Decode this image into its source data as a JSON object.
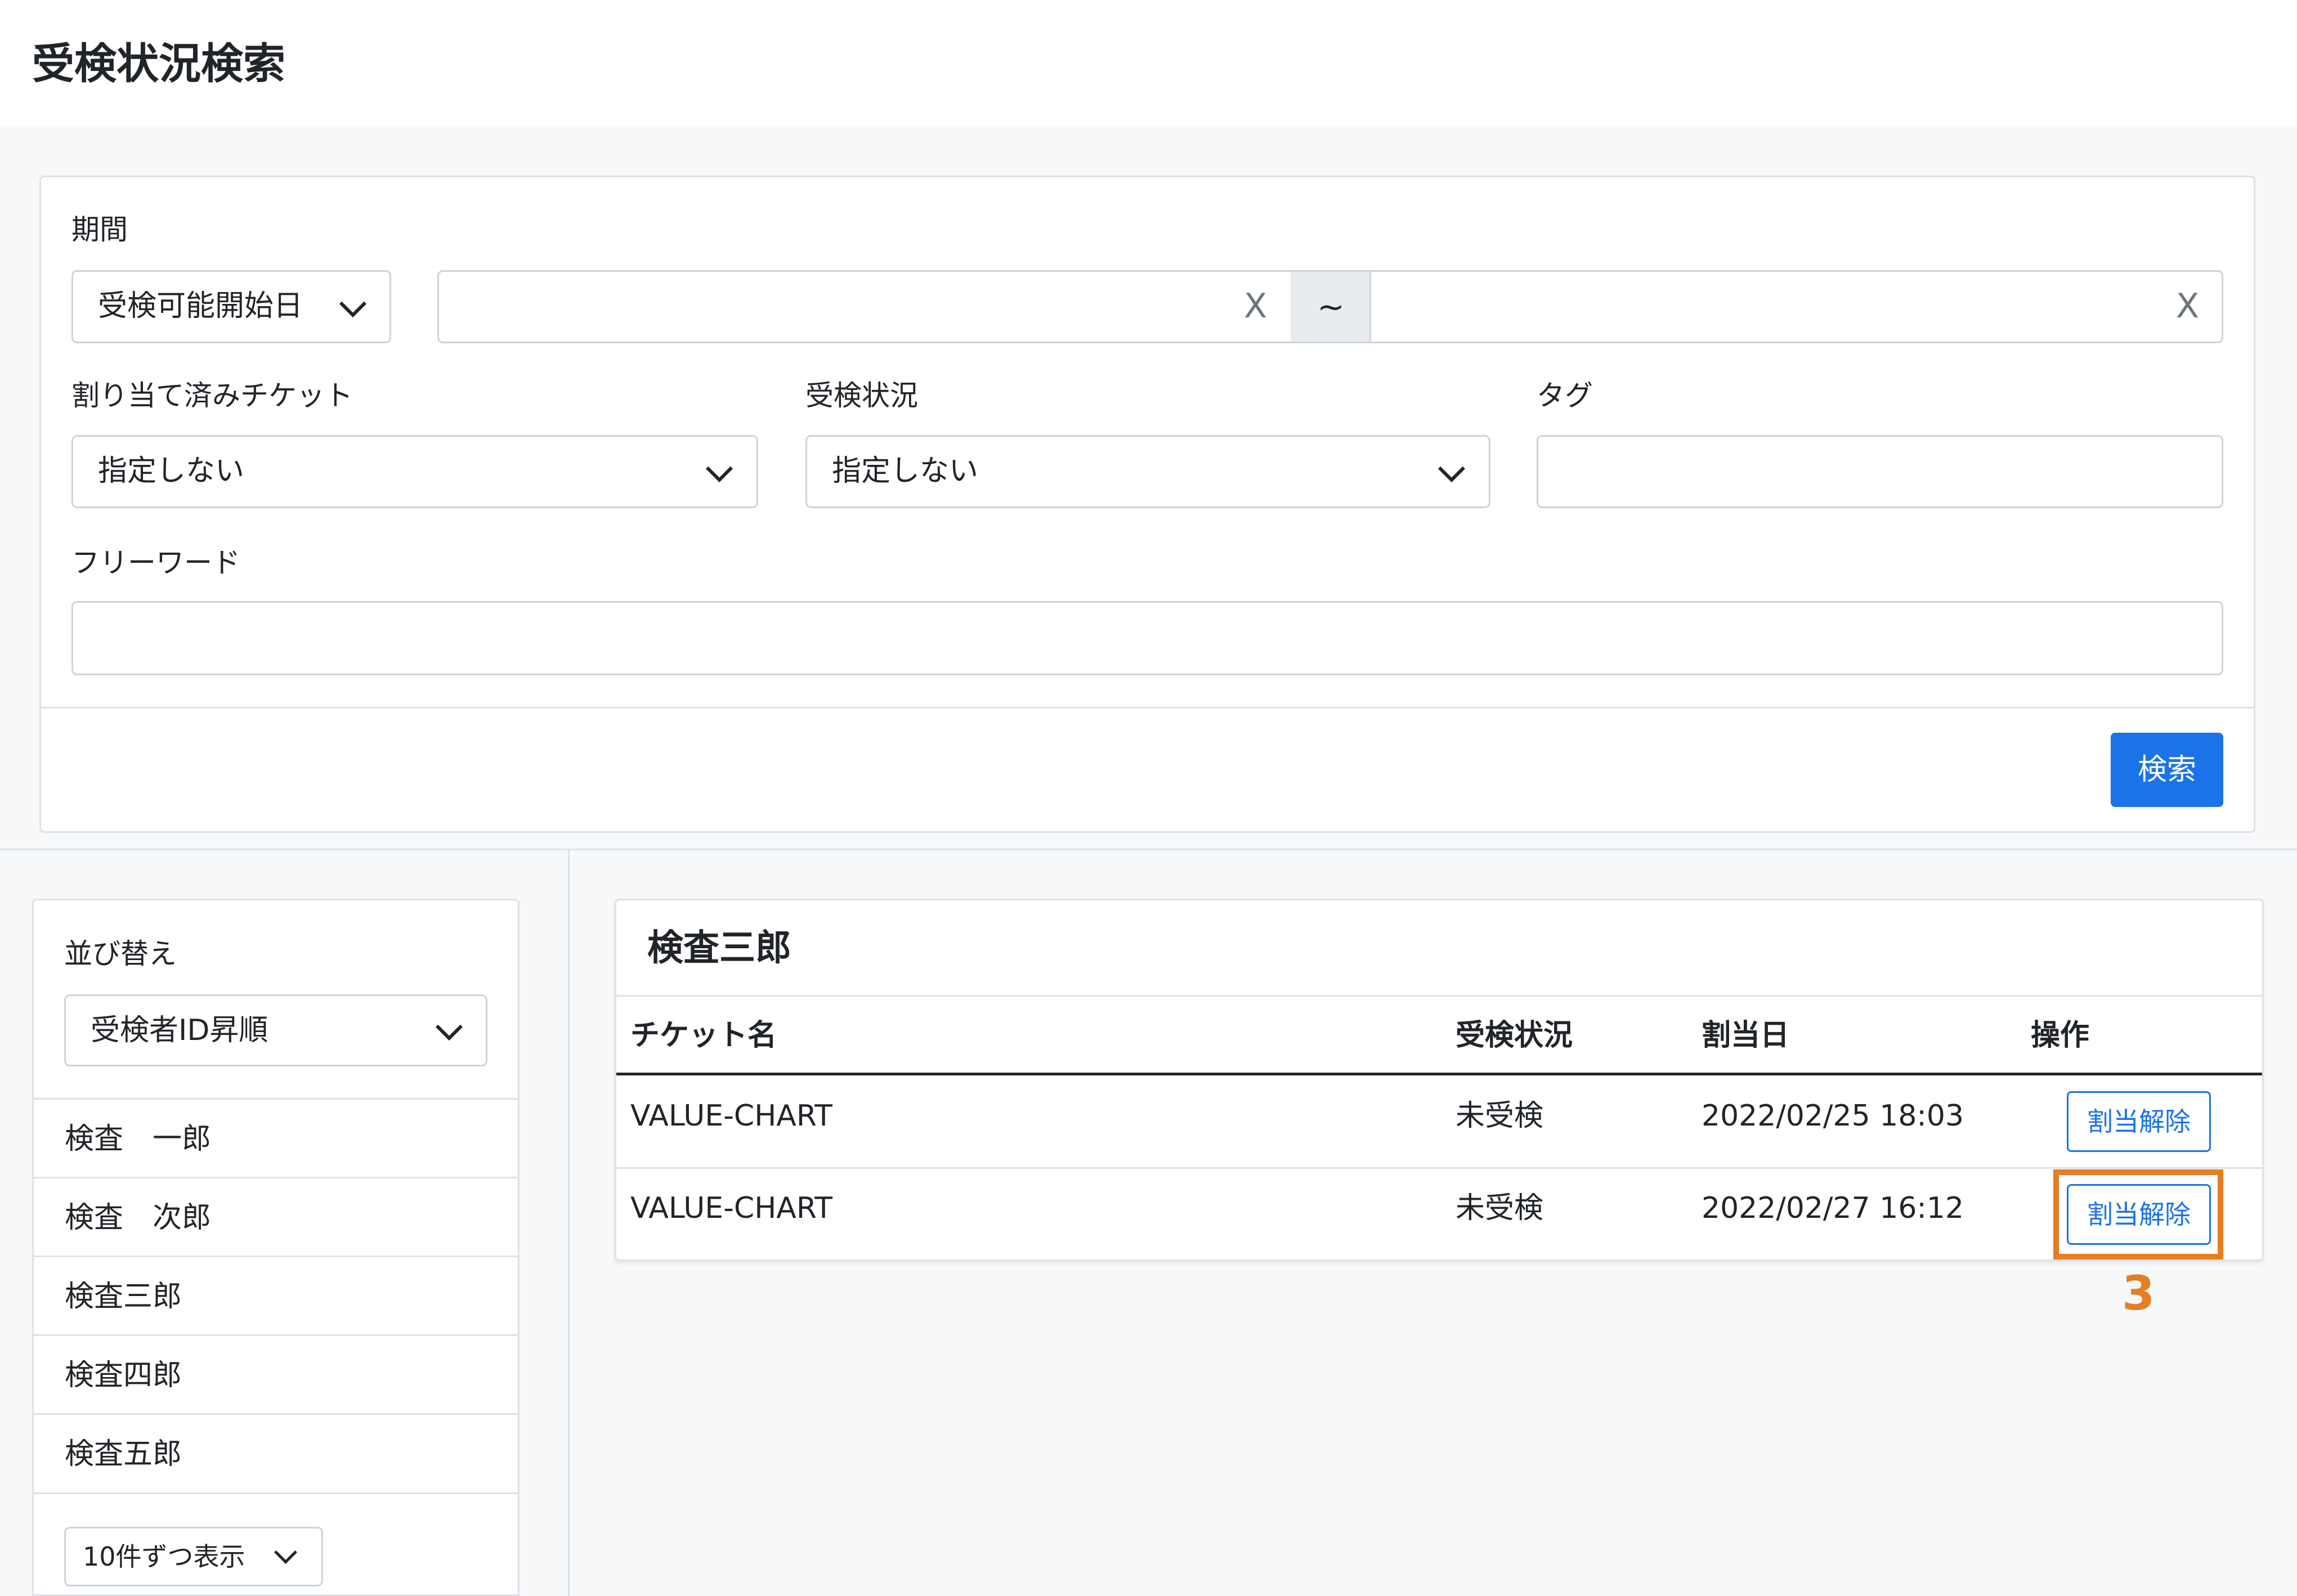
{
  "page_title": "受検状況検索",
  "search": {
    "period_label": "期間",
    "period_type": "受検可能開始日",
    "date_from": "",
    "date_to": "",
    "clear_symbol": "X",
    "tilde": "~",
    "assigned_label": "割り当て済みチケット",
    "assigned_value": "指定しない",
    "status_label": "受検状況",
    "status_value": "指定しない",
    "tag_label": "タグ",
    "tag_value": "",
    "freeword_label": "フリーワード",
    "freeword_value": "",
    "search_button": "検索"
  },
  "sidebar": {
    "sort_label": "並び替え",
    "sort_value": "受検者ID昇順",
    "items": [
      "検査　一郎",
      "検査　次郎",
      "検査三郎",
      "検査四郎",
      "検査五郎"
    ],
    "per_page": "10件ずつ表示"
  },
  "result": {
    "title": "検査三郎",
    "columns": [
      "チケット名",
      "受検状況",
      "割当日",
      "操作"
    ],
    "rows": [
      {
        "ticket": "VALUE-CHART",
        "status": "未受検",
        "date": "2022/02/25 18:03",
        "action": "割当解除"
      },
      {
        "ticket": "VALUE-CHART",
        "status": "未受検",
        "date": "2022/02/27 16:12",
        "action": "割当解除"
      }
    ]
  },
  "annotation": {
    "number": "3",
    "color": "#e67e22"
  },
  "colors": {
    "primary": "#1a73e8",
    "highlight": "#e67e22"
  }
}
